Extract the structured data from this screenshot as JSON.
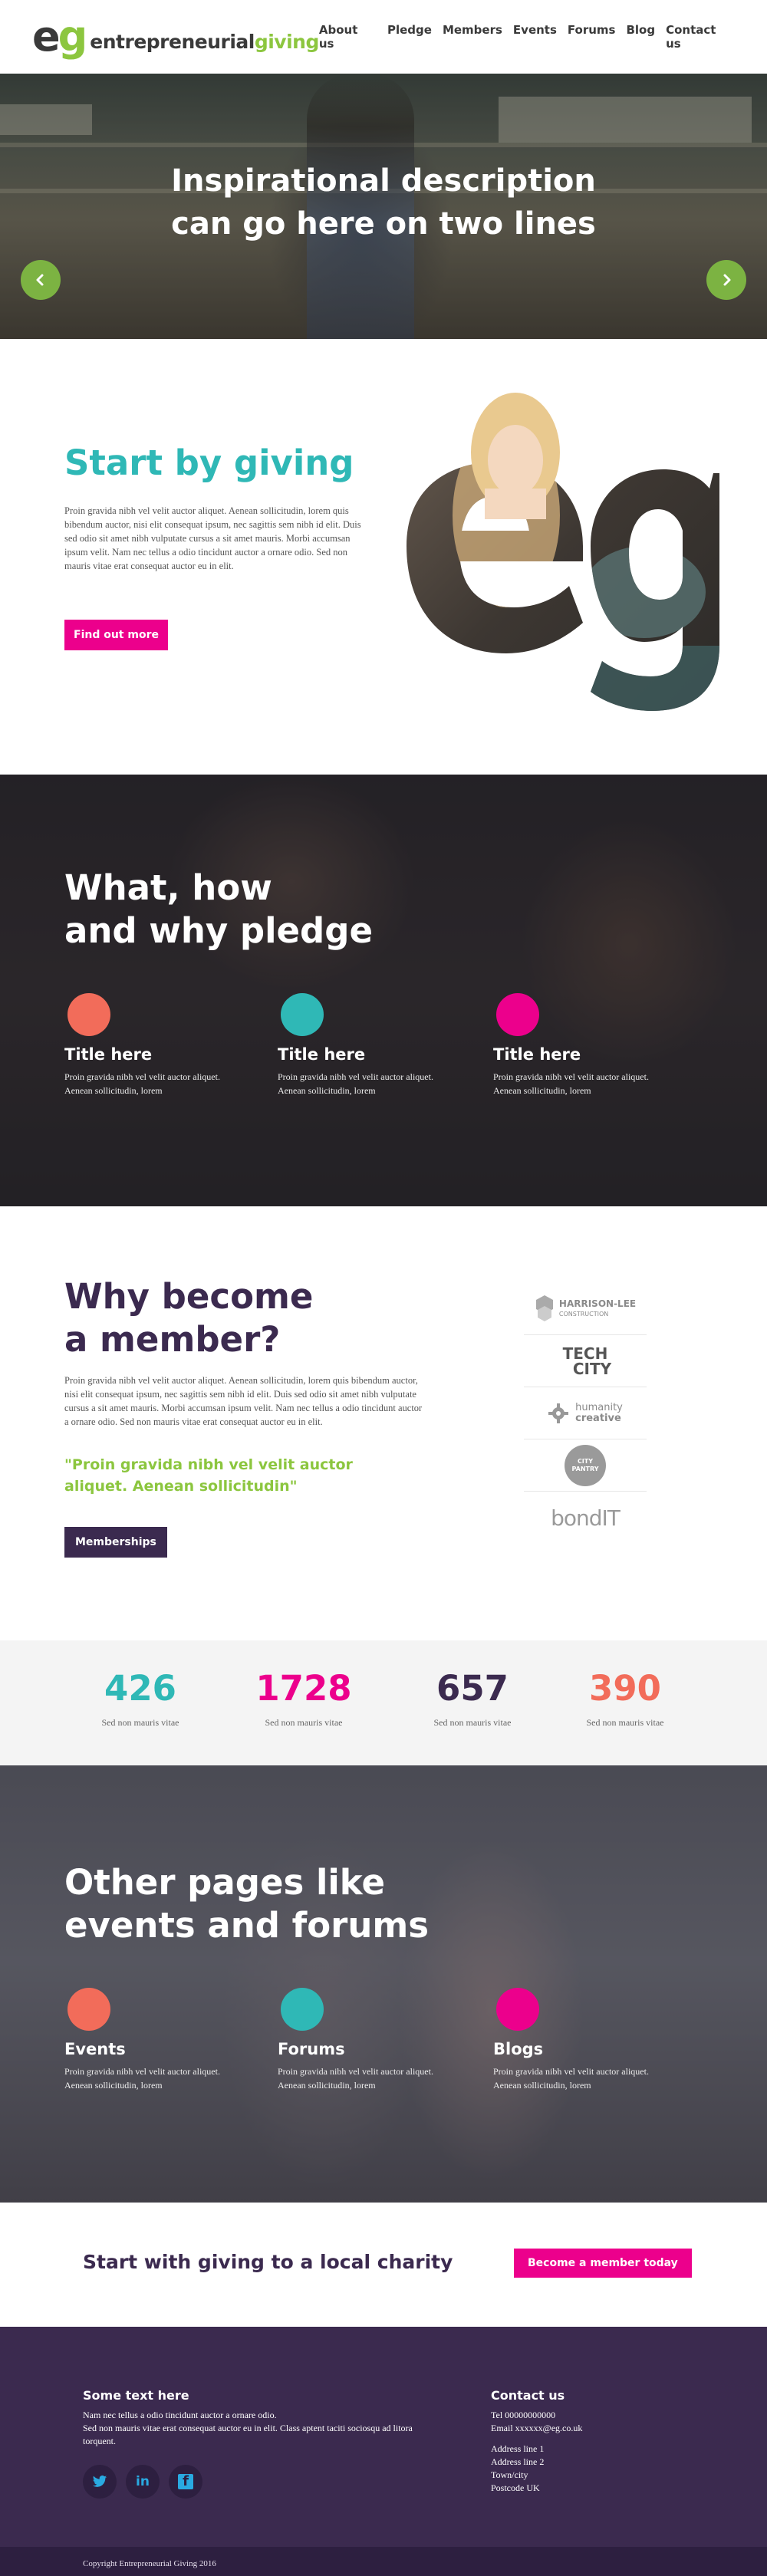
{
  "header": {
    "logo_mark_e": "e",
    "logo_mark_g": "g",
    "logo_text_a": "entrepreneurial",
    "logo_text_b": "giving",
    "nav": [
      "About us",
      "Pledge",
      "Members",
      "Events",
      "Forums",
      "Blog",
      "Contact us"
    ]
  },
  "hero": {
    "line1": "Inspirational description",
    "line2": "can go here on two lines",
    "prev_icon": "chevron-left-icon",
    "next_icon": "chevron-right-icon"
  },
  "start": {
    "title": "Start by giving",
    "body": "Proin gravida nibh vel velit auctor aliquet. Aenean sollicitudin, lorem quis bibendum auctor, nisi elit consequat ipsum, nec sagittis sem nibh id elit. Duis sed odio sit amet nibh vulputate cursus a sit amet mauris. Morbi accumsan ipsum velit. Nam nec tellus a odio tincidunt auctor a ornare odio. Sed non  mauris vitae erat consequat auctor eu in elit.",
    "button": "Find out more"
  },
  "pledge": {
    "title_line1": "What, how",
    "title_line2": "and why pledge",
    "items": [
      {
        "title": "Title here",
        "body": "Proin gravida nibh vel velit auctor aliquet. Aenean sollicitudin, lorem",
        "color": "#f26c5a"
      },
      {
        "title": "Title here",
        "body": "Proin gravida nibh vel velit auctor aliquet. Aenean sollicitudin, lorem",
        "color": "#2fb8b6"
      },
      {
        "title": "Title here",
        "body": "Proin gravida nibh vel velit auctor aliquet. Aenean sollicitudin, lorem",
        "color": "#ec008c"
      }
    ]
  },
  "member": {
    "title_line1": "Why become",
    "title_line2": "a member?",
    "body": "Proin gravida nibh vel velit auctor aliquet. Aenean sollicitudin, lorem quis bibendum auctor, nisi elit consequat ipsum, nec sagittis sem nibh id elit. Duis sed odio sit amet nibh vulputate cursus a sit amet mauris. Morbi accumsan ipsum velit. Nam nec tellus a odio tincidunt auctor a ornare odio. Sed non  mauris vitae erat consequat auctor eu in elit.",
    "quote": "\"Proin gravida nibh vel velit auctor aliquet. Aenean sollicitudin\"",
    "button": "Memberships",
    "logos": [
      {
        "line1": "HARRISON-LEE",
        "line2": "CONSTRUCTION"
      },
      {
        "line1": "TECH",
        "line2": "CITY"
      },
      {
        "line1": "humanity",
        "line2": "creative"
      },
      {
        "line1": "CITY",
        "line2": "PANTRY"
      },
      {
        "line1": "bondIT",
        "line2": ""
      }
    ]
  },
  "stats": [
    {
      "number": "426",
      "caption": "Sed non mauris vitae",
      "color": "#2fb8b6"
    },
    {
      "number": "1728",
      "caption": "Sed non mauris vitae",
      "color": "#ec008c"
    },
    {
      "number": "657",
      "caption": "Sed non mauris vitae",
      "color": "#3b2a4f"
    },
    {
      "number": "390",
      "caption": "Sed non mauris vitae",
      "color": "#f26c5a"
    }
  ],
  "other": {
    "title_line1": "Other pages like",
    "title_line2": "events and forums",
    "items": [
      {
        "title": "Events",
        "body": "Proin gravida nibh vel velit auctor aliquet. Aenean sollicitudin, lorem",
        "color": "#f26c5a"
      },
      {
        "title": "Forums",
        "body": "Proin gravida nibh vel velit auctor aliquet. Aenean sollicitudin, lorem",
        "color": "#2fb8b6"
      },
      {
        "title": "Blogs",
        "body": "Proin gravida nibh vel velit auctor aliquet. Aenean sollicitudin, lorem",
        "color": "#ec008c"
      }
    ]
  },
  "cta": {
    "text": "Start with giving to a local charity",
    "button": "Become a member today"
  },
  "footer": {
    "left_heading": "Some text here",
    "left_body_1": "Nam nec tellus a odio tincidunt auctor a ornare odio.",
    "left_body_2": "Sed non  mauris vitae erat consequat auctor eu in elit. Class aptent taciti sociosqu ad litora torquent.",
    "social": [
      {
        "icon": "twitter-icon",
        "glyph": "t"
      },
      {
        "icon": "linkedin-icon",
        "glyph": "in"
      },
      {
        "icon": "facebook-icon",
        "glyph": "f"
      }
    ],
    "contact_heading": "Contact us",
    "tel": "Tel 00000000000",
    "email": "Email xxxxxx@eg.co.uk",
    "address": [
      "Address line 1",
      "Address line 2",
      "Town/city",
      "Postcode UK"
    ],
    "copyright": "Copyright Entrepreneurial Giving 2016"
  },
  "colors": {
    "teal": "#2fb8b6",
    "pink": "#ec008c",
    "coral": "#f26c5a",
    "purple": "#3b2a4f",
    "green": "#8cc63f"
  }
}
